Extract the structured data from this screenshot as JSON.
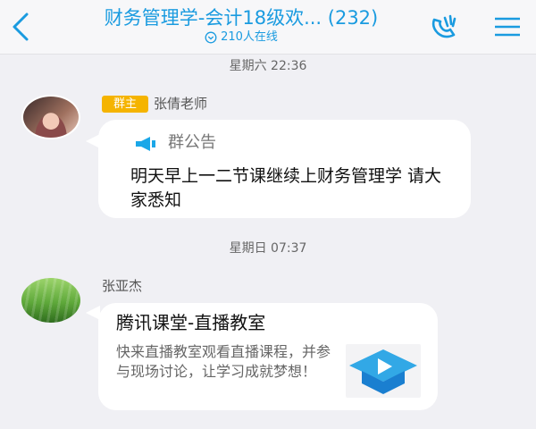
{
  "header": {
    "title": "财务管理学-会计18级欢... (232)",
    "online": "210人在线",
    "back_icon": "chevron-left-icon",
    "call_icon": "phone-call-icon",
    "menu_icon": "menu-icon",
    "accent": "#1a9be0"
  },
  "messages": [
    {
      "timestamp": "星期六 22:36",
      "badge": "群主",
      "sender": "张倩老师",
      "notice_label": "群公告",
      "text": "明天早上一二节课继续上财务管理学 请大家悉知"
    },
    {
      "timestamp": "星期日 07:37",
      "sender": "张亚杰",
      "card_title": "腾讯课堂-直播教室",
      "card_desc": "快来直播教室观看直播课程，并参与现场讨论，让学习成就梦想！"
    }
  ]
}
